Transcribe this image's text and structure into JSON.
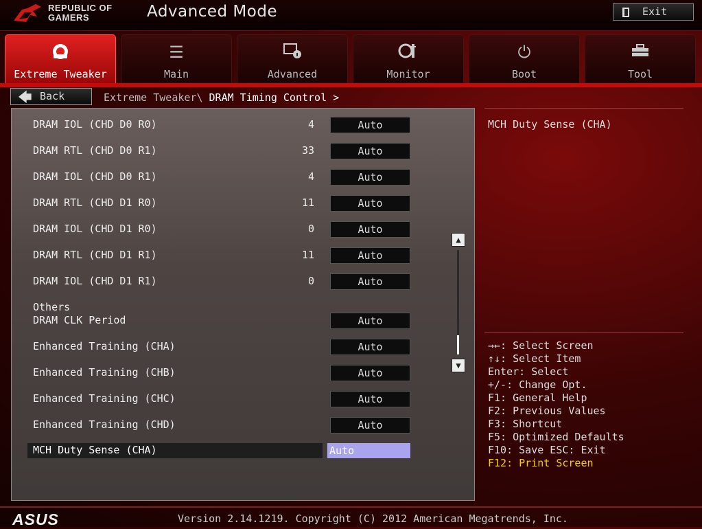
{
  "header": {
    "brand_line1": "REPUBLIC OF",
    "brand_line2": "GAMERS",
    "mode_title": "Advanced Mode",
    "exit_label": "Exit"
  },
  "tabs": [
    {
      "label": "Extreme Tweaker",
      "icon": "tweaker-icon",
      "active": true
    },
    {
      "label": "Main",
      "icon": "list-icon"
    },
    {
      "label": "Advanced",
      "icon": "advanced-icon"
    },
    {
      "label": "Monitor",
      "icon": "monitor-icon"
    },
    {
      "label": "Boot",
      "icon": "power-icon"
    },
    {
      "label": "Tool",
      "icon": "tool-icon"
    }
  ],
  "breadcrumb": {
    "back_label": "Back",
    "path": "Extreme Tweaker\\",
    "current": "DRAM Timing Control >"
  },
  "settings": [
    {
      "name": "DRAM IOL (CHD D0 R0)",
      "value": "4",
      "option": "Auto"
    },
    {
      "name": "DRAM RTL (CHD D0 R1)",
      "value": "33",
      "option": "Auto"
    },
    {
      "name": "DRAM IOL (CHD D0 R1)",
      "value": "4",
      "option": "Auto"
    },
    {
      "name": "DRAM RTL (CHD D1 R0)",
      "value": "11",
      "option": "Auto"
    },
    {
      "name": "DRAM IOL (CHD D1 R0)",
      "value": "0",
      "option": "Auto"
    },
    {
      "name": "DRAM RTL (CHD D1 R1)",
      "value": "11",
      "option": "Auto"
    },
    {
      "name": "DRAM IOL (CHD D1 R1)",
      "value": "0",
      "option": "Auto"
    }
  ],
  "others_label": "Others",
  "others": [
    {
      "name": "DRAM CLK Period",
      "option": "Auto"
    },
    {
      "name": "Enhanced Training (CHA)",
      "option": "Auto"
    },
    {
      "name": "Enhanced Training (CHB)",
      "option": "Auto"
    },
    {
      "name": "Enhanced Training (CHC)",
      "option": "Auto"
    },
    {
      "name": "Enhanced Training (CHD)",
      "option": "Auto"
    }
  ],
  "selected": {
    "name": "MCH Duty Sense (CHA)",
    "option": "Auto"
  },
  "help": {
    "title": "MCH Duty Sense (CHA)",
    "keys": [
      "→←: Select Screen",
      "↑↓: Select Item",
      "Enter: Select",
      "+/-: Change Opt.",
      "F1: General Help",
      "F2: Previous Values",
      "F3: Shortcut",
      "F5: Optimized Defaults",
      "F10: Save  ESC: Exit"
    ],
    "highlight_key": "F12: Print Screen"
  },
  "footer": {
    "brand": "ASUS",
    "version": "Version 2.14.1219. Copyright (C) 2012 American Megatrends, Inc."
  },
  "colors": {
    "accent": "#c40a0a",
    "highlight": "#f4d000",
    "selection": "#a8a4ee"
  }
}
